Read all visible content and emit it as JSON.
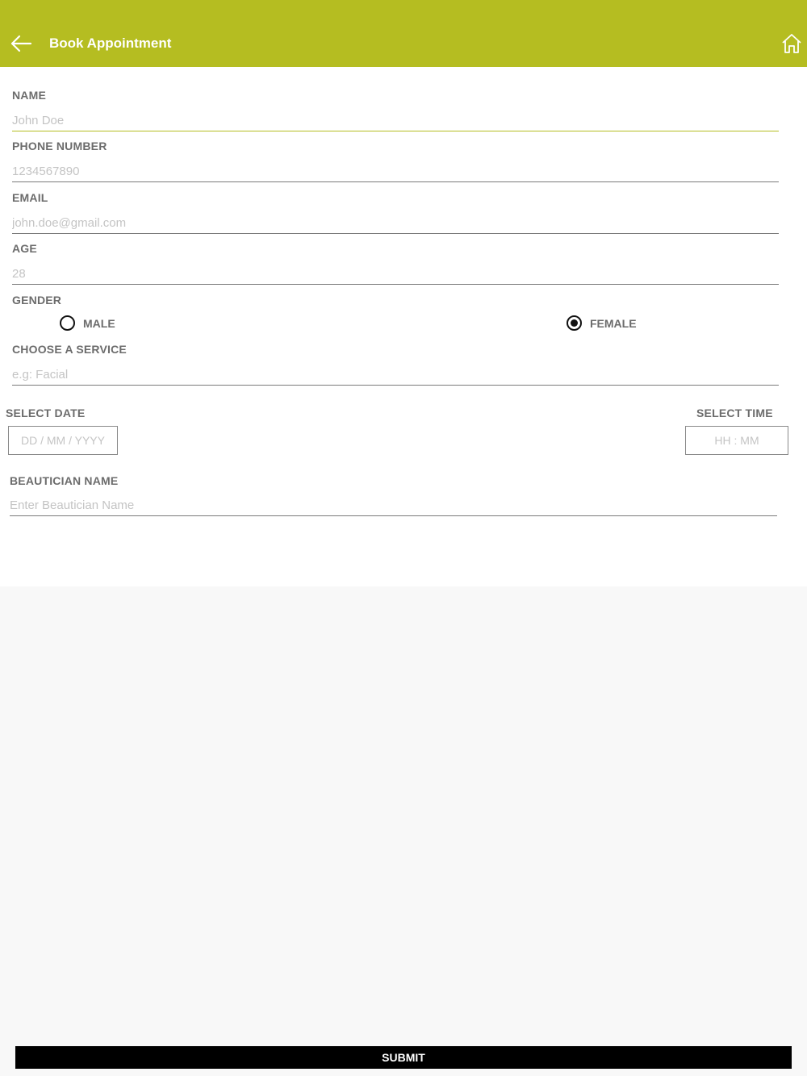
{
  "header": {
    "title": "Book Appointment",
    "back_icon": "arrow-left-icon",
    "home_icon": "home-icon",
    "color": "#b5bd21"
  },
  "form": {
    "name": {
      "label": "NAME",
      "placeholder": "John Doe"
    },
    "phone": {
      "label": "PHONE NUMBER",
      "placeholder": "1234567890"
    },
    "email": {
      "label": "EMAIL",
      "placeholder": "john.doe@gmail.com"
    },
    "age": {
      "label": "AGE",
      "placeholder": "28"
    },
    "gender": {
      "label": "GENDER",
      "options": [
        "MALE",
        "FEMALE"
      ],
      "selected": "FEMALE"
    },
    "service": {
      "label": "CHOOSE A SERVICE",
      "placeholder": "e.g: Facial"
    },
    "date": {
      "label": "SELECT DATE",
      "placeholder": "DD / MM / YYYY"
    },
    "time": {
      "label": "SELECT TIME",
      "placeholder": "HH : MM"
    },
    "beautician": {
      "label": "BEAUTICIAN NAME",
      "placeholder": "Enter Beautician Name"
    }
  },
  "submit_label": "SUBMIT"
}
